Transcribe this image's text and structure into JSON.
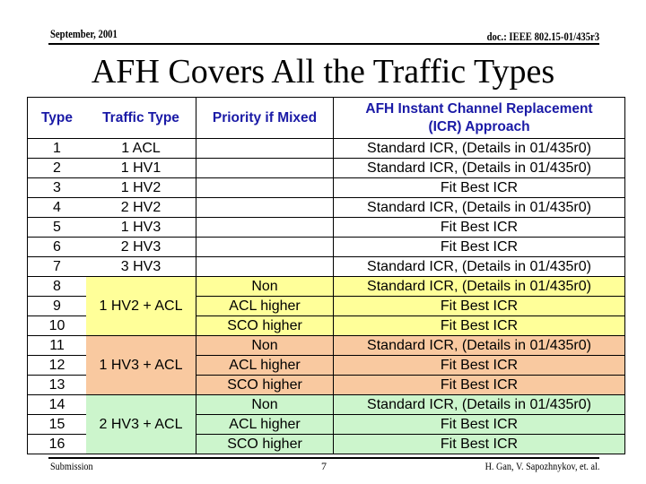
{
  "header": {
    "date": "September, 2001",
    "doc": "doc.: IEEE 802.15-01/435r3"
  },
  "title": "AFH Covers All the Traffic Types",
  "table": {
    "headers": {
      "type": "Type",
      "traffic": "Traffic Type",
      "priority": "Priority if Mixed",
      "icr_line1": "AFH Instant Channel Replacement",
      "icr_line2": "(ICR) Approach"
    },
    "rows": [
      {
        "type": "1",
        "traffic": "1 ACL",
        "priority": "",
        "icr": "Standard ICR, (Details in 01/435r0)"
      },
      {
        "type": "2",
        "traffic": "1 HV1",
        "priority": "",
        "icr": "Standard ICR, (Details in 01/435r0)"
      },
      {
        "type": "3",
        "traffic": "1 HV2",
        "priority": "",
        "icr": "Fit Best ICR"
      },
      {
        "type": "4",
        "traffic": "2 HV2",
        "priority": "",
        "icr": "Standard ICR, (Details in 01/435r0)"
      },
      {
        "type": "5",
        "traffic": "1 HV3",
        "priority": "",
        "icr": "Fit Best ICR"
      },
      {
        "type": "6",
        "traffic": "2 HV3",
        "priority": "",
        "icr": "Fit Best ICR"
      },
      {
        "type": "7",
        "traffic": "3 HV3",
        "priority": "",
        "icr": "Standard ICR, (Details in 01/435r0)"
      },
      {
        "type": "8",
        "traffic": "1 HV2 + ACL",
        "priority": "Non",
        "icr": "Standard ICR, (Details in 01/435r0)"
      },
      {
        "type": "9",
        "traffic": "",
        "priority": "ACL higher",
        "icr": "Fit Best ICR"
      },
      {
        "type": "10",
        "traffic": "",
        "priority": "SCO higher",
        "icr": "Fit Best ICR"
      },
      {
        "type": "11",
        "traffic": "1 HV3 + ACL",
        "priority": "Non",
        "icr": "Standard ICR, (Details in 01/435r0)"
      },
      {
        "type": "12",
        "traffic": "",
        "priority": "ACL higher",
        "icr": "Fit Best ICR"
      },
      {
        "type": "13",
        "traffic": "",
        "priority": "SCO higher",
        "icr": "Fit Best ICR"
      },
      {
        "type": "14",
        "traffic": "2 HV3 + ACL",
        "priority": "Non",
        "icr": "Standard ICR, (Details in 01/435r0)"
      },
      {
        "type": "15",
        "traffic": "",
        "priority": "ACL higher",
        "icr": "Fit Best ICR"
      },
      {
        "type": "16",
        "traffic": "",
        "priority": "SCO higher",
        "icr": "Fit Best ICR"
      }
    ],
    "colors": {
      "header_text": "#1a1aa6",
      "group_yellow": "#ffff99",
      "group_orange": "#f9c9a0",
      "group_green": "#ccf5cc"
    }
  },
  "footer": {
    "left": "Submission",
    "page": "7",
    "authors": "H. Gan, V. Sapozhnykov, et. al."
  }
}
